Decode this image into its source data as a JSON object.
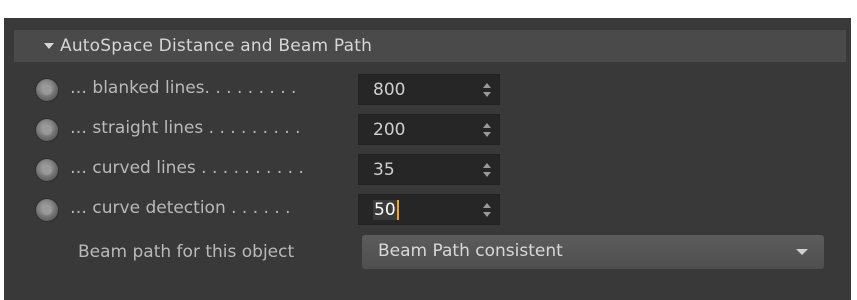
{
  "section": {
    "title": "AutoSpace Distance and Beam Path"
  },
  "rows": [
    {
      "label": "… blanked lines. . . . . . . . .",
      "value": "800"
    },
    {
      "label": "… straight lines . . . . . . . . .",
      "value": "200"
    },
    {
      "label": "… curved lines . . . . . . . . . .",
      "value": "35"
    },
    {
      "label": "… curve detection . . . . . .",
      "value": "50"
    }
  ],
  "beam_path": {
    "label": "Beam path for this object",
    "selected": "Beam Path consistent"
  },
  "colors": {
    "panel_bg": "#393939",
    "header_bg": "#4a4a4a",
    "field_bg": "#262626",
    "dropdown_bg": "#555555",
    "cursor_accent": "#f0a32a"
  },
  "icons": {
    "collapse": "triangle-down-icon",
    "stepper": "up-down-arrows-icon",
    "dropdown": "chevron-down-icon",
    "radio": "radio-button"
  }
}
